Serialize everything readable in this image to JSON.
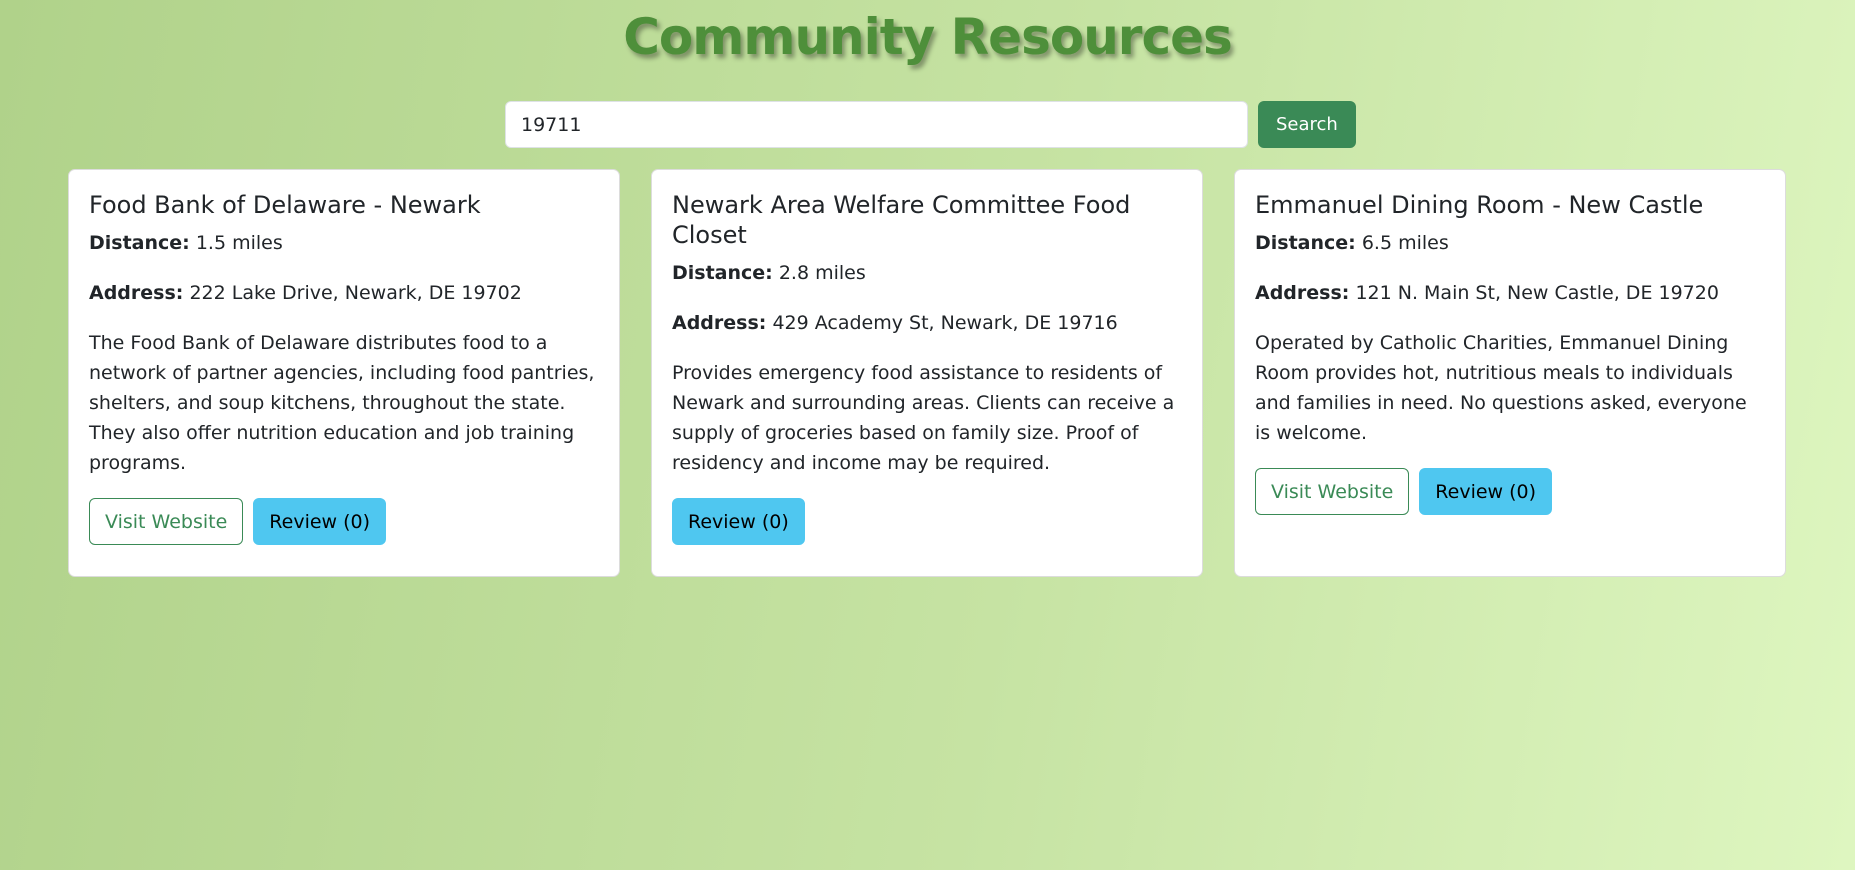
{
  "header": {
    "title": "Community Resources"
  },
  "search": {
    "value": "19711",
    "placeholder": "",
    "button_label": "Search"
  },
  "labels": {
    "distance": "Distance:",
    "address": "Address:"
  },
  "colors": {
    "title": "#4e8f3a",
    "primary_button": "#3a8a56",
    "review_button": "#4fc7f0"
  },
  "resources": [
    {
      "name": "Food Bank of Delaware - Newark",
      "distance": "1.5 miles",
      "address": "222 Lake Drive, Newark, DE 19702",
      "description": "The Food Bank of Delaware distributes food to a network of partner agencies, including food pantries, shelters, and soup kitchens, throughout the state. They also offer nutrition education and job training programs.",
      "website_label": "Visit Website",
      "review_label": "Review (0)"
    },
    {
      "name": "Newark Area Welfare Committee Food Closet",
      "distance": "2.8 miles",
      "address": "429 Academy St, Newark, DE 19716",
      "description": "Provides emergency food assistance to residents of Newark and surrounding areas. Clients can receive a supply of groceries based on family size. Proof of residency and income may be required.",
      "review_label": "Review (0)"
    },
    {
      "name": "Emmanuel Dining Room - New Castle",
      "distance": "6.5 miles",
      "address": "121 N. Main St, New Castle, DE 19720",
      "description": "Operated by Catholic Charities, Emmanuel Dining Room provides hot, nutritious meals to individuals and families in need. No questions asked, everyone is welcome.",
      "website_label": "Visit Website",
      "review_label": "Review (0)"
    }
  ]
}
